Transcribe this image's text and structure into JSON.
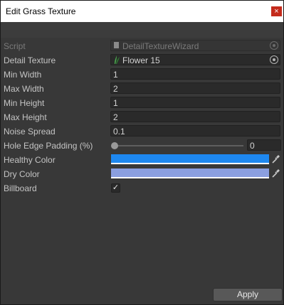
{
  "window": {
    "title": "Edit Grass Texture",
    "close_glyph": "×"
  },
  "fields": {
    "script": {
      "label": "Script",
      "value": "DetailTextureWizard"
    },
    "detail_texture": {
      "label": "Detail Texture",
      "value": "Flower 15"
    },
    "min_width": {
      "label": "Min Width",
      "value": "1"
    },
    "max_width": {
      "label": "Max Width",
      "value": "2"
    },
    "min_height": {
      "label": "Min Height",
      "value": "1"
    },
    "max_height": {
      "label": "Max Height",
      "value": "2"
    },
    "noise_spread": {
      "label": "Noise Spread",
      "value": "0.1"
    },
    "hole_edge_padding": {
      "label": "Hole Edge Padding (%)",
      "value": "0",
      "slider_fraction": 0
    },
    "healthy_color": {
      "label": "Healthy Color",
      "color": "#1e88f0"
    },
    "dry_color": {
      "label": "Dry Color",
      "color": "#8b9fe0"
    },
    "billboard": {
      "label": "Billboard",
      "checked": true,
      "check_glyph": "✓"
    }
  },
  "footer": {
    "apply_label": "Apply"
  },
  "colors": {
    "window_bg": "#383838",
    "field_bg": "#2a2a2a",
    "close_red": "#c42b1c"
  },
  "icons": {
    "script_icon": "script-file-icon",
    "texture_icon": "grass-leaf-icon",
    "picker_icon": "object-picker-icon",
    "eyedropper_icon": "eyedropper-icon"
  }
}
